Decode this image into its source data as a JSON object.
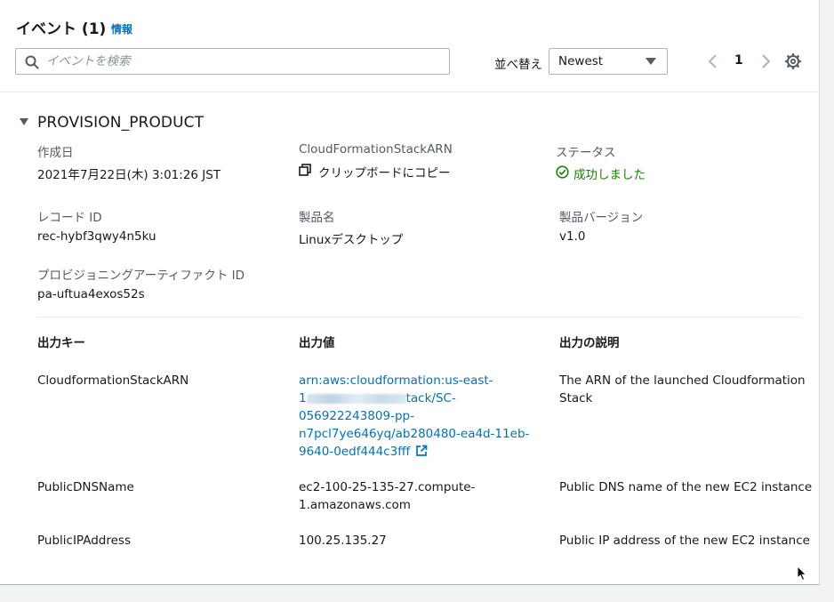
{
  "header": {
    "title": "イベント (1)",
    "info_link": "情報",
    "search": {
      "placeholder": "イベントを検索",
      "value": ""
    },
    "sort": {
      "label": "並べ替え",
      "selected": "Newest"
    },
    "pagination": {
      "current_page": "1"
    }
  },
  "event": {
    "title": "PROVISION_PRODUCT",
    "fields": {
      "created": {
        "label": "作成日",
        "value": "2021年7月22日(木) 3:01:26 JST"
      },
      "stack_arn": {
        "label": "CloudFormationStackARN",
        "value": "クリップボードにコピー"
      },
      "status": {
        "label": "ステータス",
        "value": "成功しました"
      },
      "record_id": {
        "label": "レコード ID",
        "value": "rec-hybf3qwy4n5ku"
      },
      "product_name": {
        "label": "製品名",
        "value": "Linuxデスクトップ"
      },
      "product_version": {
        "label": "製品バージョン",
        "value": "v1.0"
      },
      "artifact_id": {
        "label": "プロビジョニングアーティファクト ID",
        "value": "pa-uftua4exos52s"
      }
    },
    "outputs": {
      "columns": [
        "出力キー",
        "出力値",
        "出力の説明"
      ],
      "rows": [
        {
          "key": "CloudformationStackARN",
          "value_lines": [
            "arn:aws:cloudformation:us-east-",
            "1",
            "tack/SC-",
            "056922243809-pp-",
            "n7pcl7ye646yq/ab280480-ea4d-11eb-",
            "9640-0edf444c3fff"
          ],
          "description_lines": [
            "The ARN of the launched Cloudformation",
            "Stack"
          ]
        },
        {
          "key": "PublicDNSName",
          "value_lines": [
            "ec2-100-25-135-27.compute-",
            "1.amazonaws.com"
          ],
          "description_lines": [
            "Public DNS name of the new EC2 instance"
          ]
        },
        {
          "key": "PublicIPAddress",
          "value_lines": [
            "100.25.135.27"
          ],
          "description_lines": [
            "Public IP address of the new EC2 instance"
          ]
        }
      ]
    }
  },
  "colors": {
    "link": "#0073bb",
    "success": "#1d8102",
    "text": "#16191f",
    "label": "#545b64"
  },
  "icons": [
    "search-icon",
    "caret-down-icon",
    "chevron-left-icon",
    "chevron-right-icon",
    "gear-icon",
    "copy-icon",
    "check-circle-icon",
    "external-link-icon",
    "mouse-cursor-icon"
  ]
}
